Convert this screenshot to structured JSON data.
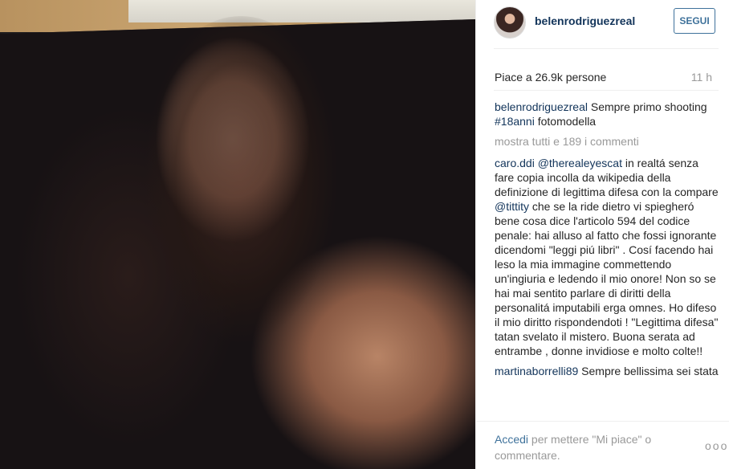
{
  "post": {
    "username": "belenrodriguezreal",
    "follow_label": "SEGUI",
    "likes_text": "Piace a 26.9k persone",
    "time_ago": "11 h",
    "caption_user": "belenrodriguezreal",
    "caption_text_1": " Sempre primo shooting ",
    "caption_tag": "#18anni",
    "caption_text_2": " fotomodella",
    "view_all": "mostra tutti e 189 i commenti"
  },
  "comments": [
    {
      "user": "caro.ddi",
      "parts": [
        {
          "type": "tag",
          "text": "@therealeyescat"
        },
        {
          "type": "text",
          "text": " in realtá senza fare copia incolla da wikipedia della definizione di legittima difesa con la compare "
        },
        {
          "type": "tag",
          "text": "@tittity"
        },
        {
          "type": "text",
          "text": " che se la ride dietro vi spiegheró bene cosa dice l'articolo 594 del codice penale: hai alluso al fatto che fossi ignorante dicendomi \"leggi piú libri\" . Cosí facendo hai leso la mia immagine commettendo un'ingiuria e ledendo il mio onore! Non so se hai mai sentito parlare di diritti della personalitá imputabili erga omnes. Ho difeso il mio diritto rispondendoti ! \"Legittima difesa\" tatan svelato il mistero. Buona serata ad entrambe , donne invidiose e molto colte!!"
        }
      ]
    },
    {
      "user": "martinaborrelli89",
      "parts": [
        {
          "type": "text",
          "text": " Sempre bellissima sei stata"
        }
      ]
    }
  ],
  "footer": {
    "login_link": "Accedi",
    "login_text": " per mettere \"Mi piace\" o commentare.",
    "more_label": "ooo"
  },
  "icons": {
    "more": "more-options-icon"
  },
  "colors": {
    "username": "#12345a",
    "link": "#3f729b",
    "muted": "#999999"
  }
}
